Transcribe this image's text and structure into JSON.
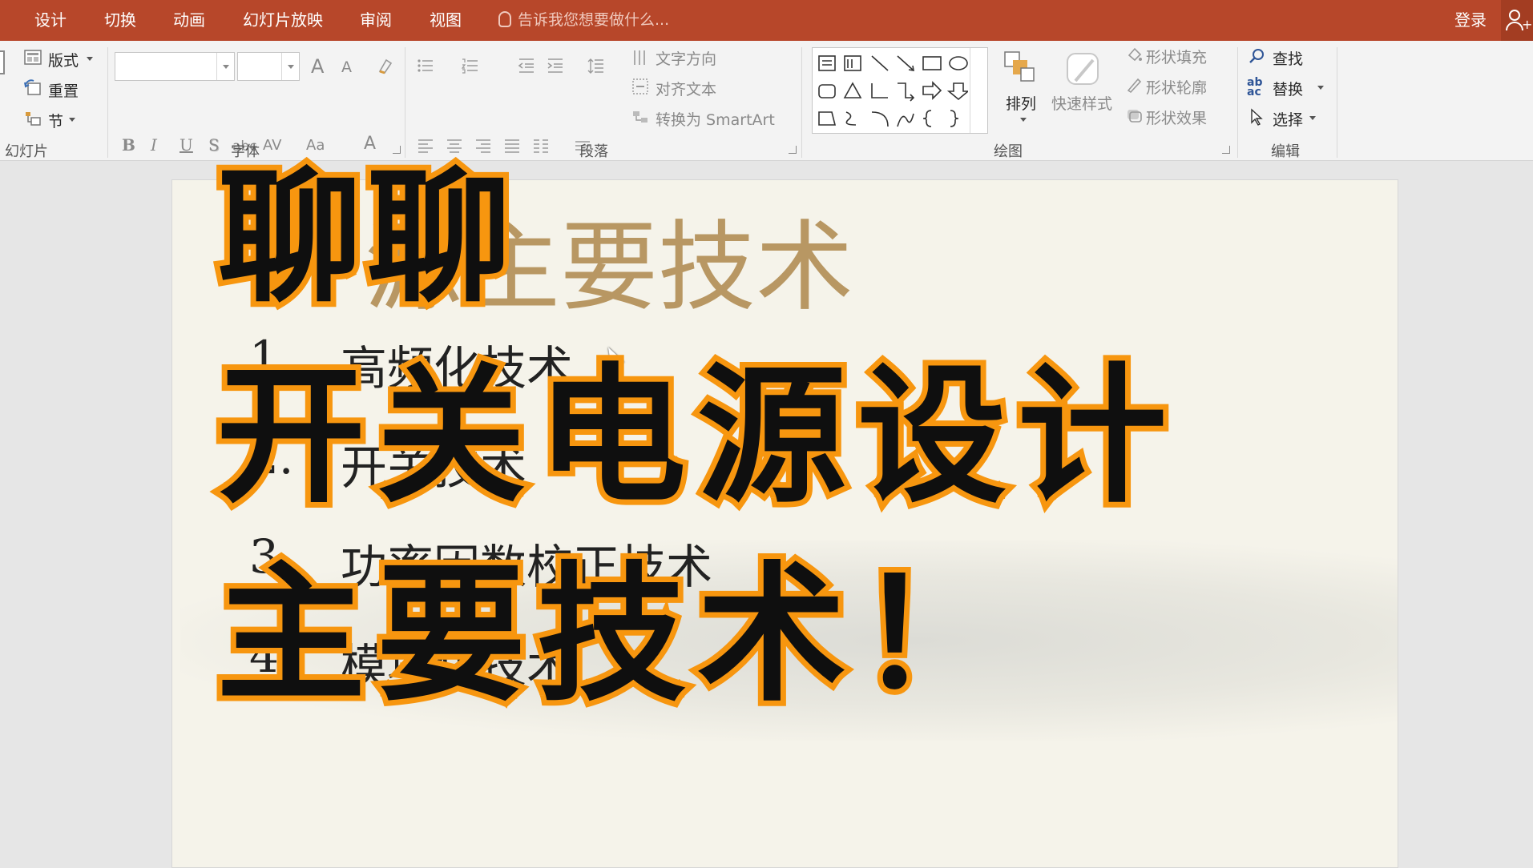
{
  "tabs": {
    "design": "设计",
    "transitions": "切换",
    "animations": "动画",
    "slideshow": "幻灯片放映",
    "review": "审阅",
    "view": "视图",
    "tell_me": "告诉我您想要做什么...",
    "login": "登录"
  },
  "ribbon": {
    "slides": {
      "layout": "版式",
      "reset": "重置",
      "section": "节",
      "label": "幻灯片"
    },
    "font": {
      "label": "字体",
      "bold": "B",
      "italic": "I",
      "underline": "U",
      "shadow": "S",
      "strike": "abc",
      "spacing": "AV",
      "case": "Aa",
      "color": "A",
      "grow": "A",
      "shrink": "A"
    },
    "paragraph": {
      "label": "段落",
      "text_direction": "文字方向",
      "align_text": "对齐文本",
      "smartart": "转换为 SmartArt"
    },
    "drawing": {
      "label": "绘图",
      "arrange": "排列",
      "quick_styles": "快速样式",
      "fill": "形状填充",
      "outline": "形状轮廓",
      "effects": "形状效果"
    },
    "editing": {
      "label": "编辑",
      "find": "查找",
      "replace": "替换",
      "select": "选择"
    }
  },
  "slide": {
    "title": "源主要技术",
    "bullets": [
      {
        "num": "1.",
        "text": "高频化技术"
      },
      {
        "num": "2.",
        "text": "开关技术"
      },
      {
        "num": "3.",
        "text": "功率因数校正技术"
      },
      {
        "num": "4.",
        "text": "模块化技术"
      }
    ]
  },
  "overlay": {
    "line1": "聊聊",
    "line2": "开关电源设计",
    "line3": "主要技术！"
  },
  "colors": {
    "accent": "#b7472a",
    "title_gold": "#b89763",
    "caption_stroke": "#f7960f",
    "caption_fill": "#0f0f0f"
  }
}
